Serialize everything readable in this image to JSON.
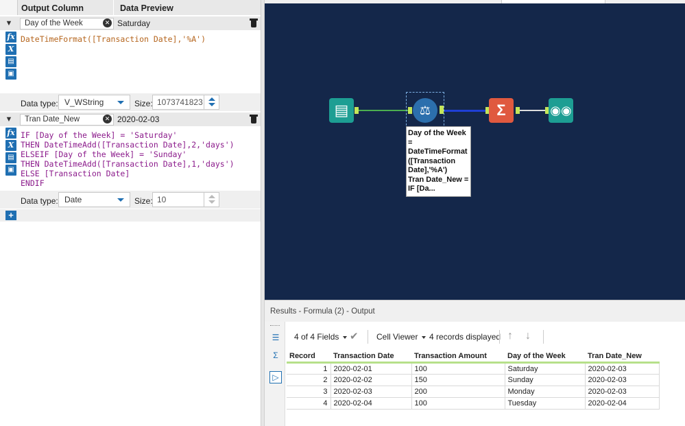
{
  "formula_panel": {
    "header": {
      "output_column": "Output Column",
      "data_preview": "Data Preview"
    },
    "formulas": [
      {
        "name": "Day of the Week",
        "preview": "Saturday",
        "expression_lines": [
          "DateTimeFormat([Transaction Date],'%A')"
        ],
        "data_type_label": "Data type:",
        "data_type": "V_WString",
        "size_label": "Size:",
        "size": "1073741823"
      },
      {
        "name": "Tran Date_New",
        "preview": "2020-02-03",
        "expression_lines": [
          "IF [Day of the Week] = 'Saturday'",
          "THEN DateTimeAdd([Transaction Date],2,'days')",
          "ELSEIF [Day of the Week] = 'Sunday'",
          "THEN DateTimeAdd([Transaction Date],1,'days')",
          "ELSE [Transaction Date]",
          "ENDIF"
        ],
        "data_type_label": "Data type:",
        "data_type": "Date",
        "size_label": "Size:",
        "size": "10"
      }
    ],
    "side_icons": [
      "fx-icon",
      "variable-icon",
      "folder-open-icon",
      "save-icon"
    ]
  },
  "canvas": {
    "tools": [
      "input-data-tool",
      "formula-tool",
      "summarize-tool",
      "browse-tool"
    ],
    "annotation": "Day of the Week\n=\nDateTimeFormat\n([Transaction\nDate],'%A')\nTran Date_New =\nIF [Da..."
  },
  "results": {
    "title": "Results - Formula (2) - Output",
    "fields": "4 of 4 Fields",
    "viewer": "Cell Viewer",
    "records_displayed": "4 records displayed",
    "columns": [
      "Record",
      "Transaction Date",
      "Transaction Amount",
      "Day of the Week",
      "Tran Date_New"
    ],
    "rows": [
      [
        "1",
        "2020-02-01",
        "100",
        "Saturday",
        "2020-02-03"
      ],
      [
        "2",
        "2020-02-02",
        "150",
        "Sunday",
        "2020-02-03"
      ],
      [
        "3",
        "2020-02-03",
        "200",
        "Monday",
        "2020-02-03"
      ],
      [
        "4",
        "2020-02-04",
        "100",
        "Tuesday",
        "2020-02-04"
      ]
    ]
  }
}
